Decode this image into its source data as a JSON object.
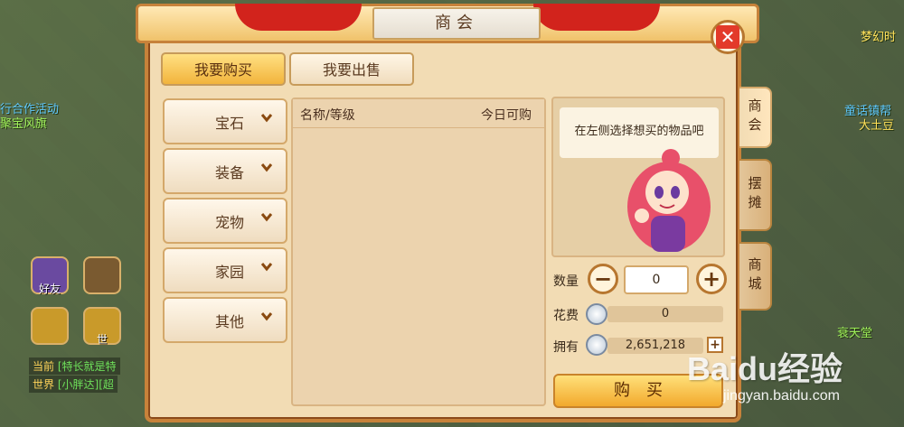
{
  "dialog": {
    "title": "商会",
    "tabs": [
      {
        "label": "我要购买",
        "active": true
      },
      {
        "label": "我要出售",
        "active": false
      }
    ],
    "categories": [
      "宝石",
      "装备",
      "宠物",
      "家园",
      "其他"
    ],
    "list_headers": {
      "name_level": "名称/等级",
      "today_available": "今日可购"
    },
    "hint": "在左侧选择想买的物品吧",
    "side_tabs": [
      {
        "label": "商会",
        "active": true
      },
      {
        "label": "摆摊",
        "active": false
      },
      {
        "label": "商城",
        "active": false
      }
    ],
    "quantity_label": "数量",
    "quantity_value": "0",
    "cost_label": "花费",
    "cost_value": "0",
    "owned_label": "拥有",
    "owned_value": "2,651,218",
    "buy_label": "购买",
    "close_icon": "close-icon"
  },
  "scene": {
    "texts": [
      {
        "text": "梦幻时",
        "cls": "yellow"
      },
      {
        "text": "行合作活动",
        "cls": "blue"
      },
      {
        "text": "聚宝风旗",
        "cls": "green"
      },
      {
        "text": "童话镇帮",
        "cls": "blue"
      },
      {
        "text": "大土豆",
        "cls": "yellow"
      },
      {
        "text": "衰天堂",
        "cls": "green"
      }
    ],
    "friend_label": "好友",
    "voice_label": "世",
    "chat": [
      {
        "tag": "当前",
        "who": "[特长就是特"
      },
      {
        "tag": "世界",
        "who": "[小胖达][超"
      }
    ]
  },
  "watermark": {
    "brand": "Baidu经验",
    "url": "jingyan.baidu.com"
  },
  "colors": {
    "accent": "#f2b43c",
    "frame": "#c7823a",
    "panel": "#f2dcb4",
    "ribbon": "#d2231c"
  }
}
